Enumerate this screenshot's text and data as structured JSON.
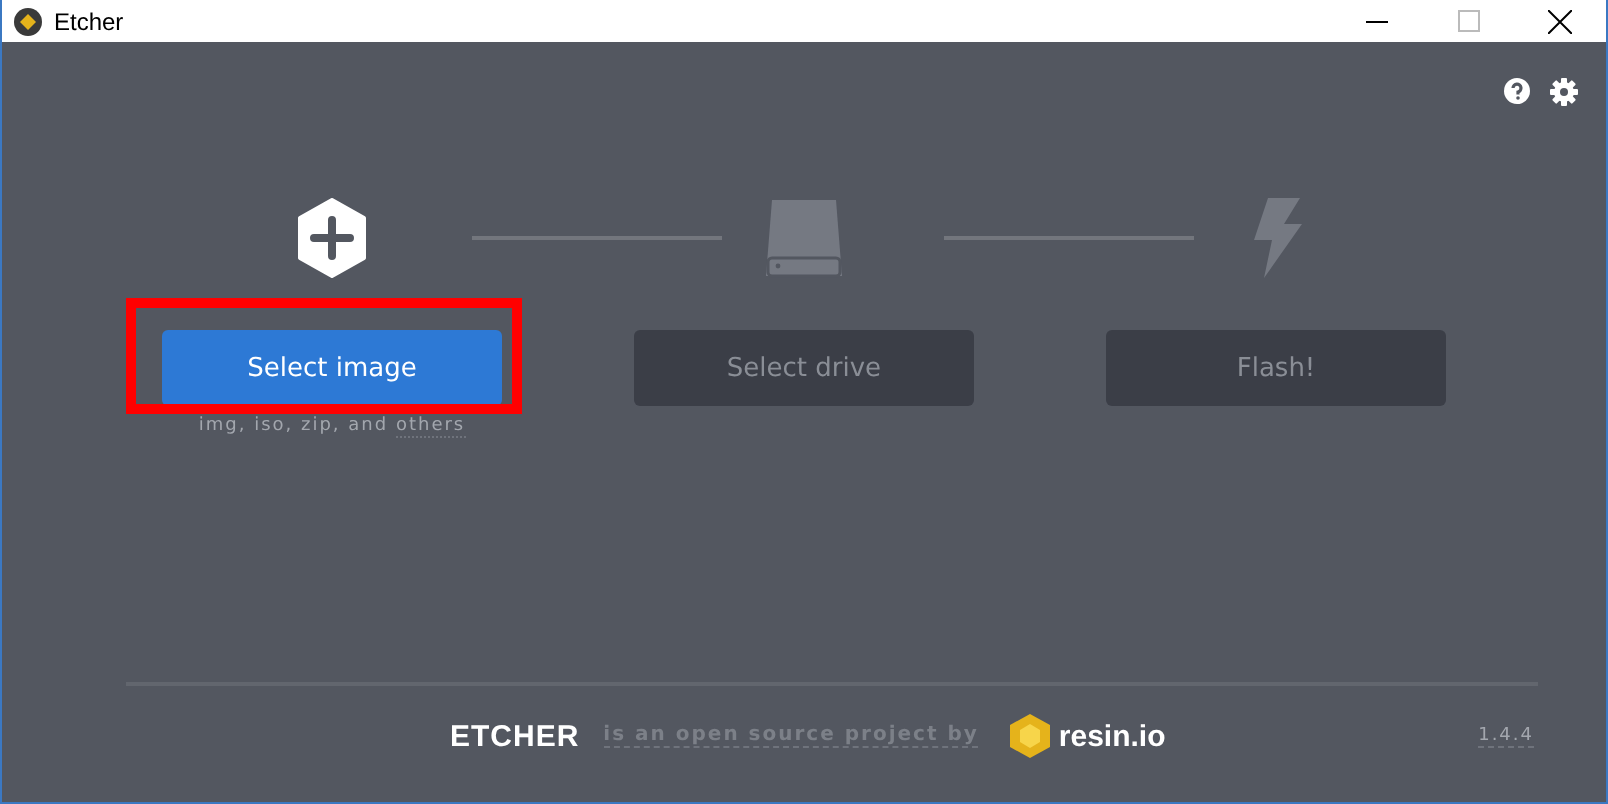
{
  "window": {
    "title": "Etcher"
  },
  "steps": [
    {
      "kind": "image",
      "button": "Select image",
      "disabled": false,
      "highlighted": true,
      "hint": "img, iso, zip, and ",
      "hint_link": "others"
    },
    {
      "kind": "drive",
      "button": "Select drive",
      "disabled": true,
      "highlighted": false
    },
    {
      "kind": "flash",
      "button": "Flash!",
      "disabled": true,
      "highlighted": false
    }
  ],
  "footer": {
    "logo": "ETCHER",
    "text": "is an open source project by",
    "company": "resin.io",
    "version": "1.4.4"
  }
}
